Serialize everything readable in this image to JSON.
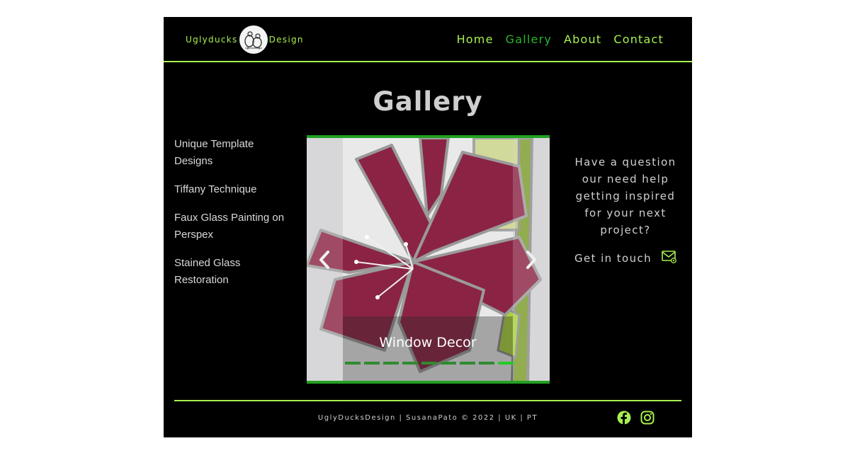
{
  "header": {
    "brand_left": "Uglyducks",
    "brand_right": "Design",
    "nav": [
      {
        "label": "Home",
        "active": false
      },
      {
        "label": "Gallery",
        "active": true
      },
      {
        "label": "About",
        "active": false
      },
      {
        "label": "Contact",
        "active": false
      }
    ]
  },
  "main": {
    "title": "Gallery",
    "categories": [
      {
        "label": "Unique Template Designs"
      },
      {
        "label": "Tiffany Technique"
      },
      {
        "label": "Faux Glass Painting on Perspex"
      },
      {
        "label": "Stained Glass Restoration"
      }
    ],
    "carousel": {
      "caption": "Window Decor",
      "slide_count": 9,
      "active_slide": 9,
      "prev_icon": "chevron-left-icon",
      "next_icon": "chevron-right-icon"
    },
    "contact": {
      "question": "Have a question our need help getting inspired for your next project?",
      "cta_label": "Get in touch",
      "cta_icon": "mail-icon"
    }
  },
  "footer": {
    "text": "UglyDucksDesign | SusanaPato © 2022 | UK | PT",
    "social_icons": [
      "facebook-icon",
      "instagram-icon"
    ]
  },
  "colors": {
    "accent": "#a8f050",
    "active_nav": "#2bb52b",
    "carousel_border": "#22a022",
    "background": "#000000"
  }
}
